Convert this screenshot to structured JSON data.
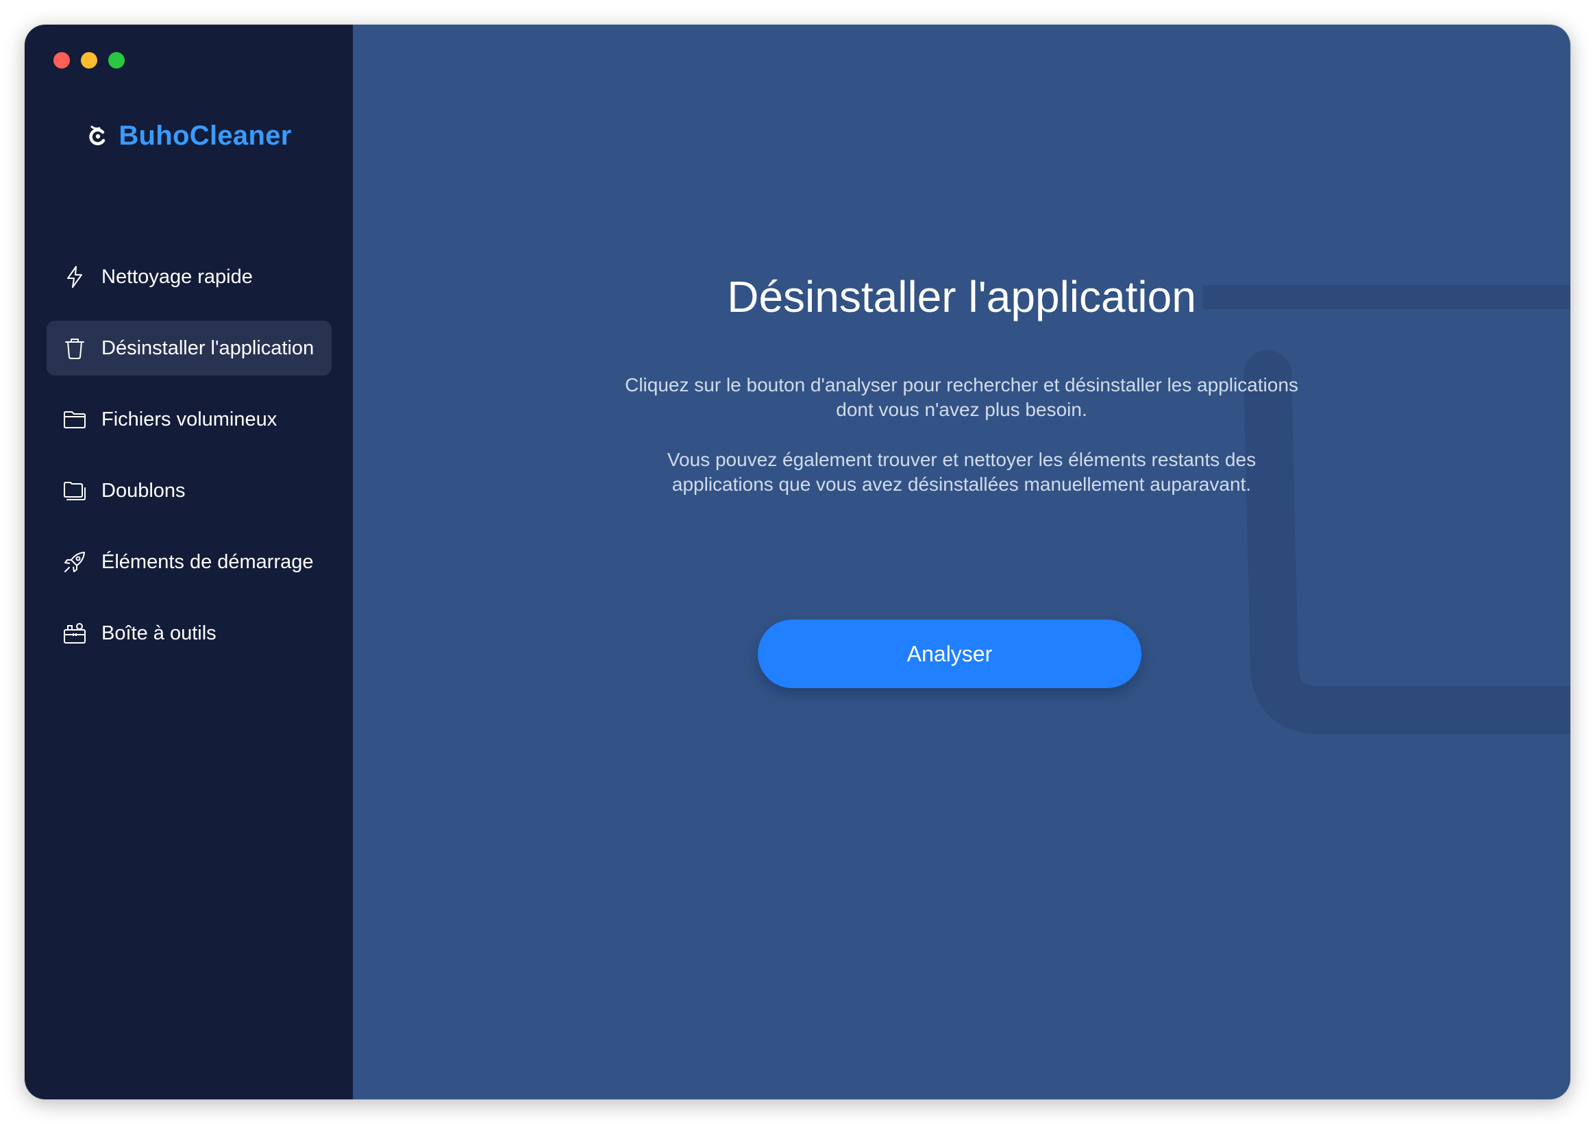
{
  "app": {
    "name": "BuhoCleaner",
    "brand_color": "#3a9bff",
    "logo_icon": "buho-logo-icon"
  },
  "window_controls": [
    "close",
    "minimize",
    "maximize"
  ],
  "sidebar": {
    "items": [
      {
        "label": "Nettoyage rapide",
        "icon": "lightning-icon",
        "active": false
      },
      {
        "label": "Désinstaller l'application",
        "icon": "trash-icon",
        "active": true
      },
      {
        "label": "Fichiers volumineux",
        "icon": "folder-icon",
        "active": false
      },
      {
        "label": "Doublons",
        "icon": "duplicate-folder-icon",
        "active": false
      },
      {
        "label": "Éléments de démarrage",
        "icon": "rocket-icon",
        "active": false
      },
      {
        "label": "Boîte à outils",
        "icon": "toolbox-icon",
        "active": false
      }
    ]
  },
  "main": {
    "title": "Désinstaller l'application",
    "description_1_line_1": "Cliquez sur le bouton d'analyser pour rechercher et désinstaller les applications",
    "description_1_line_2": "dont vous n'avez plus besoin.",
    "description_2_line_1": "Vous pouvez également trouver et nettoyer les éléments restants des",
    "description_2_line_2": "applications que vous avez désinstallées manuellement auparavant.",
    "button_label": "Analyser",
    "background_icon": "trash-icon"
  },
  "colors": {
    "sidebar_bg": "#131c38",
    "main_bg": "#335386",
    "button_bg": "#2080ff"
  }
}
